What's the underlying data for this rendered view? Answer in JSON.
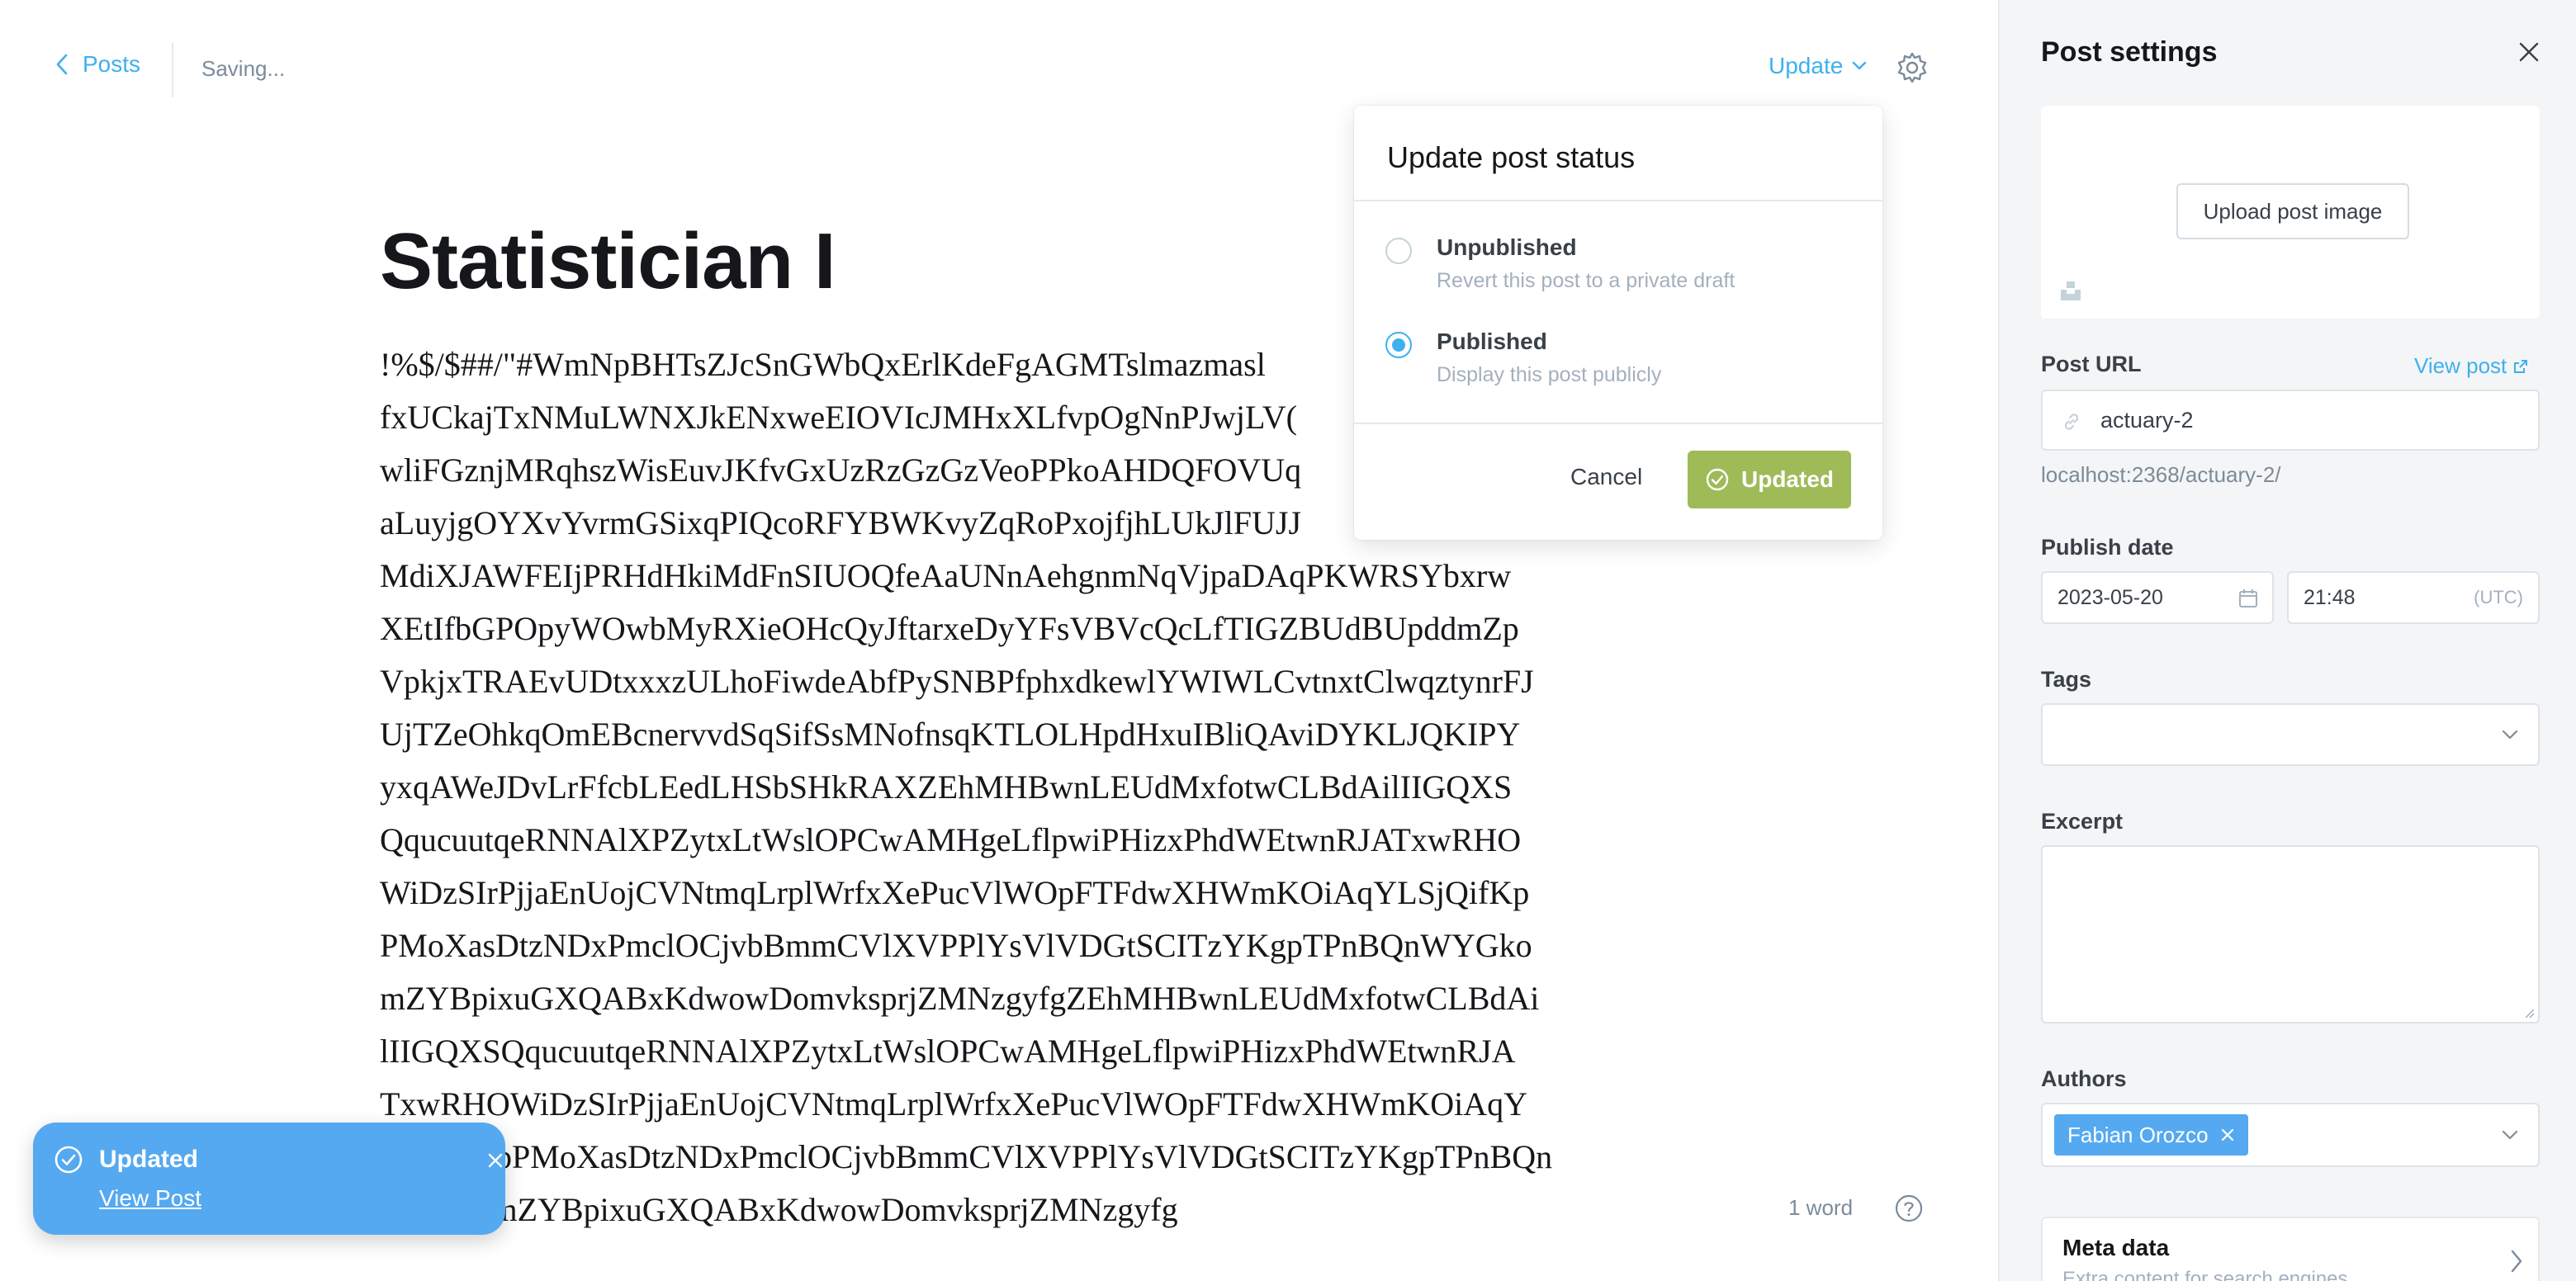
{
  "colors": {
    "accent": "#3eb0ef",
    "success": "#9fbb58",
    "toast": "#55a9f0",
    "sidebar_bg": "#f4f5f6"
  },
  "header": {
    "back_label": "Posts",
    "save_status": "Saving...",
    "update_label": "Update",
    "settings_icon": "gear-icon"
  },
  "post": {
    "title": "Statistician I",
    "body_lines": [
      "!%$/$##/\"#WmNpBHTsZJcSnGWbQxErlKdeFgAGMTslmazmasl",
      "fxUCkajTxNMuLWNXJkENxweEIOVIcJMHxXLfvpOgNnPJwjLV(",
      "wliFGznjMRqhszWisEuvJKfvGxUzRzGzGzVeoPPkoAHDQFOVUq",
      "aLuyjgOYXvYvrmGSixqPIQcoRFYBWKvyZqRoPxojfjhLUkJlFUJJ",
      "MdiXJAWFEIjPRHdHkiMdFnSIUOQfeAaUNnAehgnmNqVjpaDAqPKWRSYbxrw",
      "XEtIfbGPOpyWOwbMyRXieOHcQyJftarxeDyYFsVBVcQcLfTIGZBUdBUpddmZp",
      "VpkjxTRAEvUDtxxxzULhoFiwdeAbfPySNBPfphxdkewlYWIWLCvtnxtClwqztynrFJ",
      "UjTZeOhkqOmEBcnervvdSqSifSsMNofnsqKTLOLHpdHxuIBliQAviDYKLJQKIPY",
      "yxqAWeJDvLrFfcbLEedLHSbSHkRAXZEhMHBwnLEUdMxfotwCLBdAilIIGQXS",
      "QqucuutqeRNNAlXPZytxLtWslOPCwAMHgeLflpwiPHizxPhdWEtwnRJATxwRHO",
      "WiDzSIrPjjaEnUojCVNtmqLrplWrfxXePucVlWOpFTFdwXHWmKOiAqYLSjQifKp",
      "PMoXasDtzNDxPmclOCjvbBmmCVlXVPPlYsVlVDGtSCITzYKgpTPnBQnWYGko",
      "mZYBpixuGXQABxKdwowDomvksprjZMNzgyfgZEhMHBwnLEUdMxfotwCLBdAi",
      "lIIGQXSQqucuutqeRNNAlXPZytxLtWslOPCwAMHgeLflpwiPHizxPhdWEtwnRJA",
      "TxwRHOWiDzSIrPjjaEnUojCVNtmqLrplWrfxXePucVlWOpFTFdwXHWmKOiAqY",
      "LSjQifKpPMoXasDtzNDxPmclOCjvbBmmCVlXVPPlYsVlVDGtSCITzYKgpTPnBQn",
      "WYGkomZYBpixuGXQABxKdwowDomvksprjZMNzgyfg"
    ],
    "word_count": "1 word"
  },
  "publish_menu": {
    "title": "Update post status",
    "options": [
      {
        "label": "Unpublished",
        "description": "Revert this post to a private draft",
        "selected": false
      },
      {
        "label": "Published",
        "description": "Display this post publicly",
        "selected": true
      }
    ],
    "cancel_label": "Cancel",
    "confirm_label": "Updated"
  },
  "toast": {
    "title": "Updated",
    "link_label": "View Post"
  },
  "settings": {
    "title": "Post settings",
    "upload_label": "Upload post image",
    "url_label": "Post URL",
    "view_post_label": "View post",
    "slug": "actuary-2",
    "url_hint": "localhost:2368/actuary-2/",
    "publish_date_label": "Publish date",
    "date": "2023-05-20",
    "time": "21:48",
    "timezone": "(UTC)",
    "tags_label": "Tags",
    "excerpt_label": "Excerpt",
    "authors_label": "Authors",
    "author_chip": "Fabian Orozco",
    "meta_title": "Meta data",
    "meta_desc": "Extra content for search engines"
  }
}
